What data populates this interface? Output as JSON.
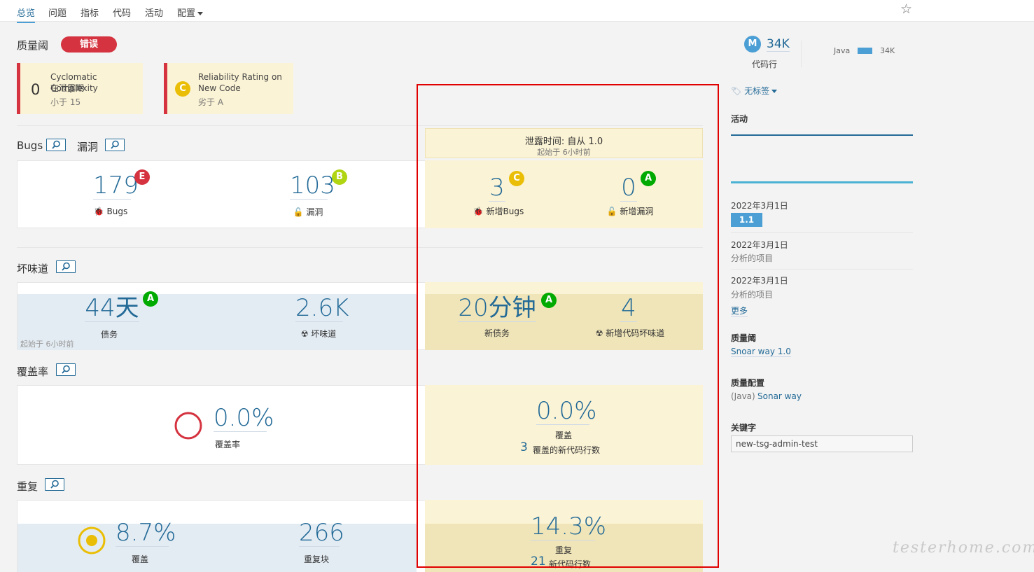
{
  "nav": {
    "items": [
      "总览",
      "问题",
      "指标",
      "代码",
      "活动",
      "配置"
    ]
  },
  "quality_gate": {
    "title": "质量阈",
    "status": "错误",
    "conditions": [
      {
        "value": "0",
        "metric": "Cyclomatic Complexity",
        "period": "在泄露期",
        "threshold": "小于 15"
      },
      {
        "rating": "C",
        "metric_line1": "Reliability Rating on",
        "metric_line2": "New Code",
        "threshold": "劣于 A"
      }
    ]
  },
  "leak": {
    "title": "泄露时间: 自从 1.0",
    "since": "起始于 6小时前"
  },
  "bugs_section": {
    "bugs_title": "Bugs",
    "vuln_title": "漏洞",
    "bugs_value": "179",
    "bugs_rating": "E",
    "bugs_label": "Bugs",
    "vuln_value": "103",
    "vuln_rating": "B",
    "vuln_label": "漏洞",
    "new_bugs_value": "3",
    "new_bugs_rating": "C",
    "new_bugs_label": "新增Bugs",
    "new_vuln_value": "0",
    "new_vuln_rating": "A",
    "new_vuln_label": "新增漏洞"
  },
  "smells_section": {
    "title": "坏味道",
    "debt_value": "44天",
    "debt_rating": "A",
    "debt_label": "债务",
    "debt_since": "起始于 6小时前",
    "smells_value": "2.6K",
    "smells_label": "坏味道",
    "new_debt_value": "20分钟",
    "new_debt_rating": "A",
    "new_debt_label": "新债务",
    "new_smells_value": "4",
    "new_smells_label": "新增代码坏味道"
  },
  "coverage_section": {
    "title": "覆盖率",
    "coverage_value": "0.0%",
    "coverage_label": "覆盖率",
    "new_coverage_value": "0.0%",
    "new_coverage_label": "覆盖",
    "new_lines_value": "3",
    "new_lines_label": "覆盖的新代码行数"
  },
  "dup_section": {
    "title": "重复",
    "dup_value": "8.7%",
    "dup_label": "覆盖",
    "blocks_value": "266",
    "blocks_label": "重复块",
    "new_dup_value": "14.3%",
    "new_dup_label": "重复",
    "new_dup_lines_value": "21",
    "new_dup_lines_label": "新代码行数"
  },
  "sidebar": {
    "size_badge": "M",
    "loc_value": "34K",
    "loc_label": "代码行",
    "lang_name": "Java",
    "lang_value": "34K",
    "tags": "无标签",
    "activity_title": "活动",
    "events": [
      {
        "date": "2022年3月1日",
        "version": "1.1"
      },
      {
        "date": "2022年3月1日",
        "desc": "分析的项目"
      },
      {
        "date": "2022年3月1日",
        "desc": "分析的项目"
      }
    ],
    "more": "更多",
    "gate_title": "质量阈",
    "gate_value": "Snoar way 1.0",
    "profile_title": "质量配置",
    "profile_lang": "(Java)",
    "profile_value": "Sonar way",
    "key_title": "关键字",
    "key_value": "new-tsg-admin-test"
  },
  "watermark": "testerhome.com",
  "colors": {
    "accent": "#236a97",
    "error": "#d4333f",
    "rating_A": "#00aa00",
    "rating_B": "#b0d513",
    "rating_C": "#eabe06",
    "rating_E": "#d4333f",
    "leak_bg": "#fbf3d5"
  }
}
